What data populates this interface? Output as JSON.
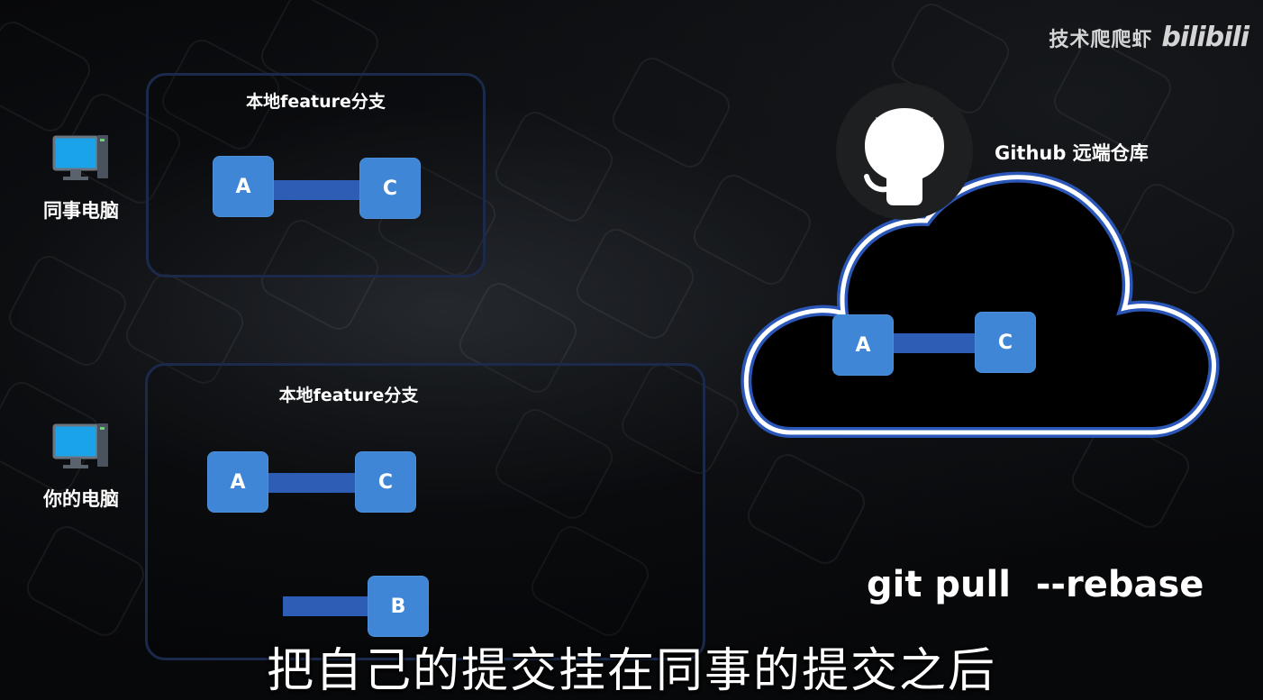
{
  "watermark": {
    "channel": "技术爬爬虾",
    "logo": "bilibili"
  },
  "colleague": {
    "device_label": "同事电脑",
    "panel_title": "本地feature分支",
    "commits": [
      "A",
      "C"
    ]
  },
  "mine": {
    "device_label": "你的电脑",
    "panel_title": "本地feature分支",
    "commits": [
      "A",
      "C"
    ],
    "pending_commit": "B"
  },
  "remote": {
    "label": "Github 远端仓库",
    "icon": "github-octocat-icon",
    "commits": [
      "A",
      "C"
    ]
  },
  "command": "git pull  --rebase",
  "subtitle": "把自己的提交挂在同事的提交之后",
  "colors": {
    "commit_node": "#3f86d6",
    "commit_edge": "#2d5db5",
    "panel_border": "#1b2a4a",
    "cloud_outline": "#ffffff",
    "cloud_inner": "#2a56b8"
  }
}
